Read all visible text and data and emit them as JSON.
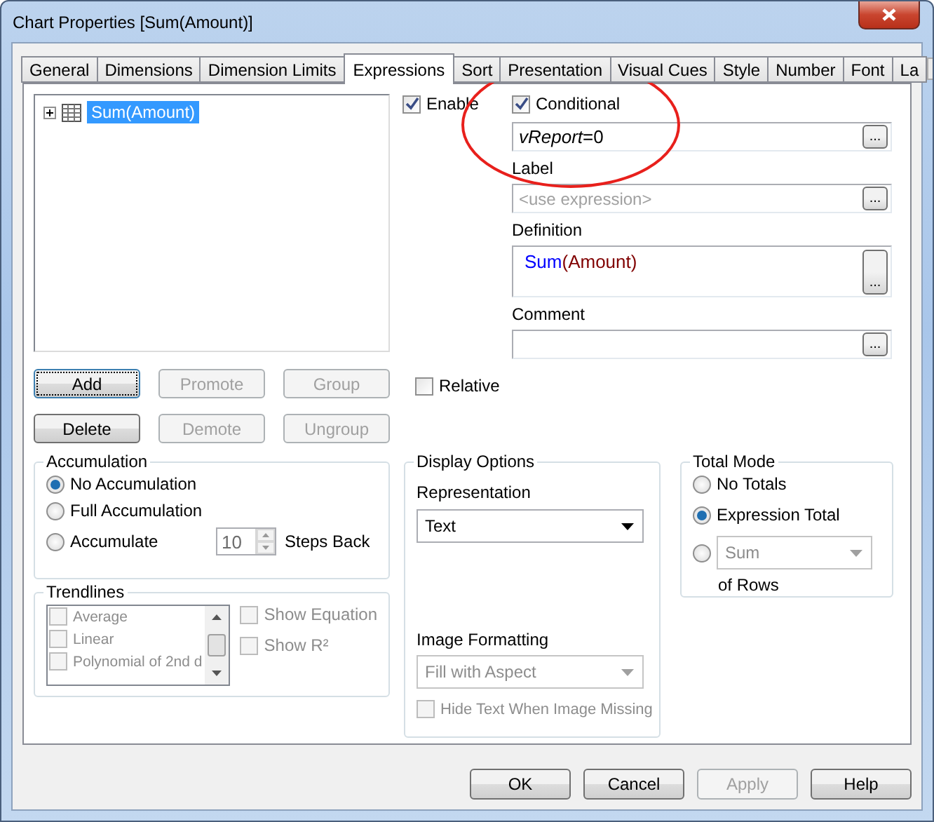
{
  "window": {
    "title": "Chart Properties [Sum(Amount)]"
  },
  "tabs": [
    {
      "label": "General",
      "selected": false
    },
    {
      "label": "Dimensions",
      "selected": false
    },
    {
      "label": "Dimension Limits",
      "selected": false
    },
    {
      "label": "Expressions",
      "selected": true
    },
    {
      "label": "Sort",
      "selected": false
    },
    {
      "label": "Presentation",
      "selected": false
    },
    {
      "label": "Visual Cues",
      "selected": false
    },
    {
      "label": "Style",
      "selected": false
    },
    {
      "label": "Number",
      "selected": false
    },
    {
      "label": "Font",
      "selected": false
    },
    {
      "label": "La",
      "selected": false
    }
  ],
  "expressions_tree": [
    {
      "label": "Sum(Amount)",
      "selected": true,
      "expanded": false
    }
  ],
  "expression_buttons": [
    {
      "label": "Add",
      "disabled": false,
      "focused": true
    },
    {
      "label": "Promote",
      "disabled": true,
      "focused": false
    },
    {
      "label": "Group",
      "disabled": true,
      "focused": false
    },
    {
      "label": "Delete",
      "disabled": false,
      "focused": false
    },
    {
      "label": "Demote",
      "disabled": true,
      "focused": false
    },
    {
      "label": "Ungroup",
      "disabled": true,
      "focused": false
    }
  ],
  "enable": {
    "label": "Enable",
    "checked": true
  },
  "conditional": {
    "label": "Conditional",
    "checked": true,
    "value": "*vReport*=0",
    "button": "..."
  },
  "label_field": {
    "label": "Label",
    "placeholder": "<use expression>",
    "button": "..."
  },
  "definition": {
    "label": "Definition",
    "tokens": [
      {
        "text": "Sum",
        "color": "#0000ff"
      },
      {
        "text": "(Amount)",
        "color": "#800000"
      }
    ],
    "button": "..."
  },
  "comment": {
    "label": "Comment",
    "button": "..."
  },
  "relative": {
    "label": "Relative",
    "checked": false
  },
  "accumulation": {
    "title": "Accumulation",
    "options": [
      {
        "label": "No Accumulation",
        "selected": true
      },
      {
        "label": "Full Accumulation",
        "selected": false
      },
      {
        "label": "Accumulate",
        "selected": false
      }
    ],
    "steps": "10",
    "steps_label": "Steps Back"
  },
  "trendlines": {
    "title": "Trendlines",
    "disabled": true,
    "items": [
      {
        "label": "Average",
        "checked": false
      },
      {
        "label": "Linear",
        "checked": false
      },
      {
        "label": "Polynomial of 2nd d",
        "checked": false
      }
    ],
    "options": [
      {
        "label": "Show Equation",
        "checked": false
      },
      {
        "label": "Show R²",
        "checked": false
      }
    ]
  },
  "display_options": {
    "title": "Display Options",
    "representation": {
      "label": "Representation",
      "value": "Text",
      "disabled": false
    },
    "image_formatting": {
      "label": "Image Formatting",
      "value": "Fill with Aspect",
      "disabled": true
    },
    "hide_text": {
      "label": "Hide Text When Image Missing",
      "checked": false,
      "disabled": true
    }
  },
  "total_mode": {
    "title": "Total Mode",
    "options": [
      {
        "kind": "label",
        "label": "No Totals",
        "selected": false
      },
      {
        "kind": "label",
        "label": "Expression Total",
        "selected": true
      },
      {
        "kind": "dropdown",
        "value": "Sum",
        "selected": false
      }
    ],
    "suffix": "of Rows"
  },
  "dialog_buttons": [
    {
      "label": "OK",
      "disabled": false
    },
    {
      "label": "Cancel",
      "disabled": false
    },
    {
      "label": "Apply",
      "disabled": true
    },
    {
      "label": "Help",
      "disabled": false
    }
  ]
}
